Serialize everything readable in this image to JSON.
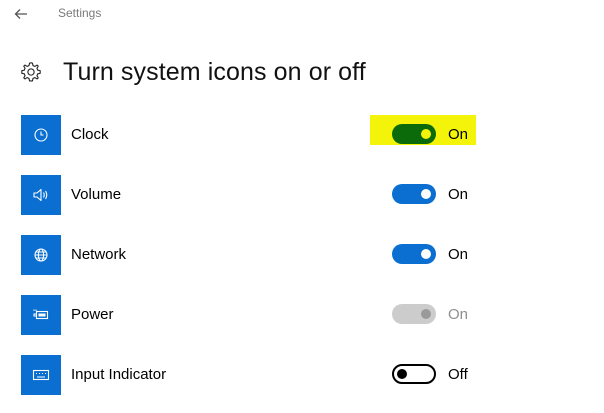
{
  "window": {
    "title": "Settings"
  },
  "page": {
    "title": "Turn system icons on or off"
  },
  "icons": {
    "back": "back-arrow-icon",
    "gear": "gear-icon"
  },
  "colors": {
    "accent": "#0a6fd0",
    "highlight": "#f4f40a",
    "highlight_toggle": "#0b6b0b",
    "disabled": "#cccccc"
  },
  "items": [
    {
      "label": "Clock",
      "state": "On",
      "on": true,
      "disabled": false,
      "icon": "clock-icon",
      "highlighted": true
    },
    {
      "label": "Volume",
      "state": "On",
      "on": true,
      "disabled": false,
      "icon": "volume-icon",
      "highlighted": false
    },
    {
      "label": "Network",
      "state": "On",
      "on": true,
      "disabled": false,
      "icon": "globe-icon",
      "highlighted": false
    },
    {
      "label": "Power",
      "state": "On",
      "on": true,
      "disabled": true,
      "icon": "battery-icon",
      "highlighted": false
    },
    {
      "label": "Input Indicator",
      "state": "Off",
      "on": false,
      "disabled": false,
      "icon": "keyboard-icon",
      "highlighted": false
    }
  ]
}
